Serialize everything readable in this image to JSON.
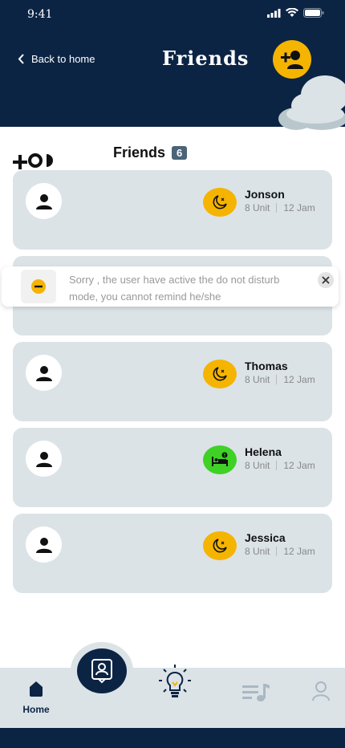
{
  "status_bar": {
    "time": "9:41"
  },
  "header": {
    "back_label": "Back to home",
    "title": "Friends"
  },
  "section": {
    "title": "Friends",
    "count": "6"
  },
  "friends": [
    {
      "name": "Jonson",
      "units": "8 Unit",
      "time": "12 Jam",
      "status": "do-not-disturb"
    },
    {
      "name": "",
      "units": "",
      "time": "",
      "status": ""
    },
    {
      "name": "Thomas",
      "units": "8 Unit",
      "time": "12 Jam",
      "status": "do-not-disturb"
    },
    {
      "name": "Helena",
      "units": "8 Unit",
      "time": "12 Jam",
      "status": "sleeping"
    },
    {
      "name": "Jessica",
      "units": "8 Unit",
      "time": "12 Jam",
      "status": "do-not-disturb"
    }
  ],
  "toast": {
    "message": "Sorry , the user have active the do not disturb mode, you cannot remind he/she"
  },
  "nav": {
    "home_label": "Home"
  },
  "colors": {
    "navy": "#0c2444",
    "accent": "#f5b400",
    "sleep_green": "#3fd126",
    "card": "#dbe3e7"
  }
}
